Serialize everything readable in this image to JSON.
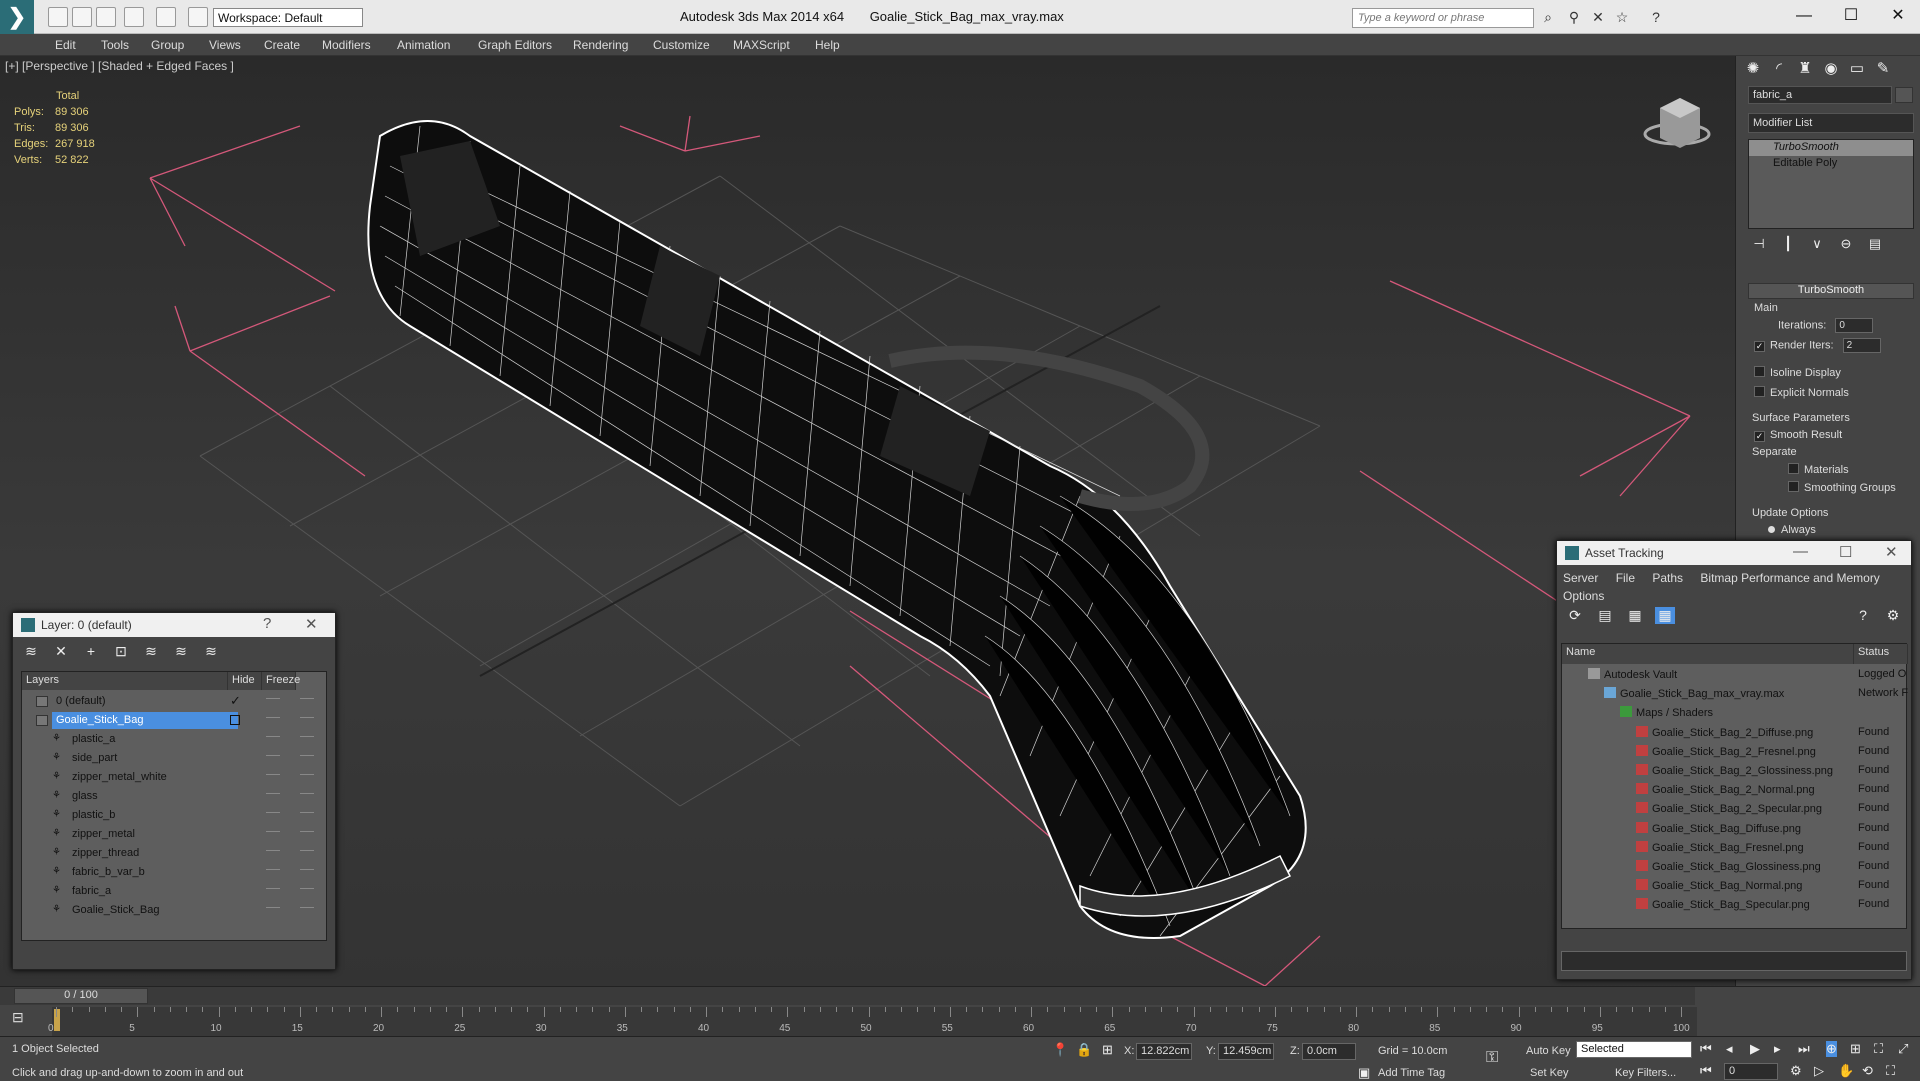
{
  "app": {
    "title": "Autodesk 3ds Max  2014 x64",
    "file": "Goalie_Stick_Bag_max_vray.max",
    "workspace": "Workspace: Default",
    "search_placeholder": "Type a keyword or phrase"
  },
  "menu": [
    "Edit",
    "Tools",
    "Group",
    "Views",
    "Create",
    "Modifiers",
    "Animation",
    "Graph Editors",
    "Rendering",
    "Customize",
    "MAXScript",
    "Help"
  ],
  "viewport": {
    "label": "[+] [Perspective ] [Shaded + Edged Faces ]",
    "stats_header": "Total",
    "stats": [
      {
        "k": "Polys:",
        "v": "89 306"
      },
      {
        "k": "Tris:",
        "v": "89 306"
      },
      {
        "k": "Edges:",
        "v": "267 918"
      },
      {
        "k": "Verts:",
        "v": "52 822"
      }
    ]
  },
  "command_panel": {
    "object_name": "fabric_a",
    "modifier_list": "Modifier List",
    "stack": [
      "TurboSmooth",
      "Editable Poly"
    ],
    "rollout_title": "TurboSmooth",
    "main_label": "Main",
    "iterations_label": "Iterations:",
    "iterations_value": "0",
    "render_iters_label": "Render Iters:",
    "render_iters_value": "2",
    "render_iters_checked": true,
    "isoline_label": "Isoline Display",
    "explicit_label": "Explicit Normals",
    "surface_label": "Surface Parameters",
    "smooth_result_label": "Smooth Result",
    "separate_label": "Separate",
    "materials_label": "Materials",
    "smoothing_groups_label": "Smoothing Groups",
    "update_label": "Update Options",
    "always_label": "Always"
  },
  "layer_explorer": {
    "title": "Layer: 0 (default)",
    "columns": [
      "Layers",
      "Hide",
      "Freeze"
    ],
    "rows": [
      {
        "name": "0 (default)",
        "level": 1,
        "selected": false,
        "current": true
      },
      {
        "name": "Goalie_Stick_Bag",
        "level": 1,
        "selected": true,
        "current": false
      },
      {
        "name": "plastic_a",
        "level": 2
      },
      {
        "name": "side_part",
        "level": 2
      },
      {
        "name": "zipper_metal_white",
        "level": 2
      },
      {
        "name": "glass",
        "level": 2
      },
      {
        "name": "plastic_b",
        "level": 2
      },
      {
        "name": "zipper_metal",
        "level": 2
      },
      {
        "name": "zipper_thread",
        "level": 2
      },
      {
        "name": "fabric_b_var_b",
        "level": 2
      },
      {
        "name": "fabric_a",
        "level": 2
      },
      {
        "name": "Goalie_Stick_Bag",
        "level": 2
      }
    ]
  },
  "asset_tracking": {
    "title": "Asset Tracking",
    "menu": [
      "Server",
      "File",
      "Paths",
      "Bitmap Performance and Memory"
    ],
    "menu2": "Options",
    "columns": [
      "Name",
      "Status"
    ],
    "rows": [
      {
        "name": "Autodesk Vault",
        "status": "Logged O",
        "level": 1,
        "kind": "vault"
      },
      {
        "name": "Goalie_Stick_Bag_max_vray.max",
        "status": "Network F",
        "level": 2,
        "kind": "max"
      },
      {
        "name": "Maps / Shaders",
        "status": "",
        "level": 3,
        "kind": "folder"
      },
      {
        "name": "Goalie_Stick_Bag_2_Diffuse.png",
        "status": "Found",
        "level": 4,
        "kind": "png"
      },
      {
        "name": "Goalie_Stick_Bag_2_Fresnel.png",
        "status": "Found",
        "level": 4,
        "kind": "png"
      },
      {
        "name": "Goalie_Stick_Bag_2_Glossiness.png",
        "status": "Found",
        "level": 4,
        "kind": "png"
      },
      {
        "name": "Goalie_Stick_Bag_2_Normal.png",
        "status": "Found",
        "level": 4,
        "kind": "png"
      },
      {
        "name": "Goalie_Stick_Bag_2_Specular.png",
        "status": "Found",
        "level": 4,
        "kind": "png"
      },
      {
        "name": "Goalie_Stick_Bag_Diffuse.png",
        "status": "Found",
        "level": 4,
        "kind": "png"
      },
      {
        "name": "Goalie_Stick_Bag_Fresnel.png",
        "status": "Found",
        "level": 4,
        "kind": "png"
      },
      {
        "name": "Goalie_Stick_Bag_Glossiness.png",
        "status": "Found",
        "level": 4,
        "kind": "png"
      },
      {
        "name": "Goalie_Stick_Bag_Normal.png",
        "status": "Found",
        "level": 4,
        "kind": "png"
      },
      {
        "name": "Goalie_Stick_Bag_Specular.png",
        "status": "Found",
        "level": 4,
        "kind": "png"
      }
    ]
  },
  "timeline": {
    "frame": "0 / 100",
    "ticks": [
      "0",
      "5",
      "10",
      "15",
      "20",
      "25",
      "30",
      "35",
      "40",
      "45",
      "50",
      "55",
      "60",
      "65",
      "70",
      "75",
      "80",
      "85",
      "90",
      "95",
      "100"
    ]
  },
  "status": {
    "selection": "1 Object Selected",
    "prompt": "Click and drag up-and-down to zoom in and out",
    "x_label": "X:",
    "x": "12.822cm",
    "y_label": "Y:",
    "y": "12.459cm",
    "z_label": "Z:",
    "z": "0.0cm",
    "grid": "Grid = 10.0cm",
    "add_time_tag": "Add Time Tag",
    "auto_key": "Auto Key",
    "set_key": "Set Key",
    "selected": "Selected",
    "key_filters": "Key Filters...",
    "frame_field": "0"
  },
  "colors": {
    "accent": "#2b6d77",
    "selection": "#4a8fe0",
    "stats": "#e6d27a",
    "pink_lines": "#d4587a"
  }
}
